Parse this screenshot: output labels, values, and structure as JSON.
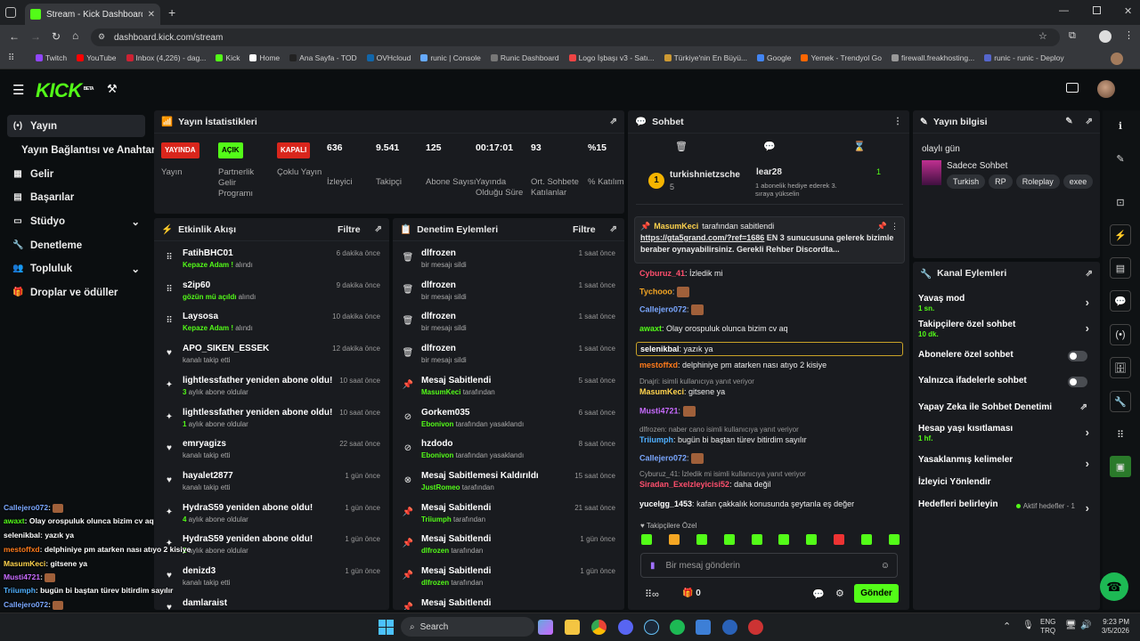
{
  "browser": {
    "tab_title": "Stream - Kick Dashboard",
    "url": "dashboard.kick.com/stream",
    "bookmarks": [
      "Twitch",
      "YouTube",
      "Inbox (4,226) - dag...",
      "Kick",
      "Home",
      "Ana Sayfa - TOD",
      "OVHcloud",
      "runic | Console",
      "Runic Dashboard",
      "Logo İşbaşı v3 - Satı...",
      "Türkiye'nin En Büyü...",
      "Google",
      "Yemek - Trendyol Go",
      "firewall.freakhosting...",
      "runic - runic - Deploy"
    ]
  },
  "kick": {
    "logo": "KICK",
    "beta": "BETA"
  },
  "sidebar": {
    "items": [
      "Yayın",
      "Yayın Bağlantısı ve Anahtarı",
      "Gelir",
      "Başarılar",
      "Stüdyo",
      "Denetleme",
      "Topluluk",
      "Droplar ve ödüller"
    ]
  },
  "stats": {
    "title": "Yayın İstatistikleri",
    "cols": [
      {
        "value": "YAYINDA",
        "label": "Yayın"
      },
      {
        "value": "AÇIK",
        "label": "Partnerlik Gelir Programı"
      },
      {
        "value": "KAPALI",
        "label": "Çoklu Yayın"
      },
      {
        "value": "636",
        "label": "İzleyici"
      },
      {
        "value": "9.541",
        "label": "Takipçi"
      },
      {
        "value": "125",
        "label": "Abone Sayısı"
      },
      {
        "value": "00:17:01",
        "label": "Yayında Olduğu Süre"
      },
      {
        "value": "93",
        "label": "Ort. Sohbete Katılanlar"
      },
      {
        "value": "%15",
        "label": "% Katılım"
      }
    ]
  },
  "activity": {
    "title": "Etkinlik Akışı",
    "filter": "Filtre",
    "items": [
      {
        "icon": "⠿",
        "title": "FatihBHC01",
        "hl": "Kepaze Adam !",
        "sub": " alındı",
        "time": "6 dakika önce"
      },
      {
        "icon": "⠿",
        "title": "s2ip60",
        "hl": "gözün mü açıldı",
        "sub": " alındı",
        "time": "9 dakika önce"
      },
      {
        "icon": "⠿",
        "title": "Laysosa",
        "hl": "Kepaze Adam !",
        "sub": " alındı",
        "time": "10 dakika önce"
      },
      {
        "icon": "♥",
        "title": "APO_SIKEN_ESSEK",
        "hl": "",
        "sub": "kanalı takip etti",
        "time": "12 dakika önce"
      },
      {
        "icon": "✦",
        "title": "lightlessfather yeniden abone oldu!",
        "hl": "3",
        "sub": " aylık abone oldular",
        "time": "10 saat önce"
      },
      {
        "icon": "✦",
        "title": "lightlessfather yeniden abone oldu!",
        "hl": "1",
        "sub": " aylık abone oldular",
        "time": "10 saat önce"
      },
      {
        "icon": "♥",
        "title": "emryagizs",
        "hl": "",
        "sub": "kanalı takip etti",
        "time": "22 saat önce"
      },
      {
        "icon": "♥",
        "title": "hayalet2877",
        "hl": "",
        "sub": "kanalı takip etti",
        "time": "1 gün önce"
      },
      {
        "icon": "✦",
        "title": "HydraS59 yeniden abone oldu!",
        "hl": "4",
        "sub": " aylık abone oldular",
        "time": "1 gün önce"
      },
      {
        "icon": "✦",
        "title": "HydraS59 yeniden abone oldu!",
        "hl": "2",
        "sub": " aylık abone oldular",
        "time": "1 gün önce"
      },
      {
        "icon": "♥",
        "title": "denizd3",
        "hl": "",
        "sub": "kanalı takip etti",
        "time": "1 gün önce"
      },
      {
        "icon": "♥",
        "title": "damlaraist",
        "hl": "",
        "sub": "",
        "time": ""
      }
    ]
  },
  "moderation": {
    "title": "Denetim Eylemleri",
    "filter": "Filtre",
    "items": [
      {
        "icon": "🗑",
        "title": "dlfrozen",
        "hl": "",
        "sub": "bir mesajı sildi",
        "time": "1 saat önce"
      },
      {
        "icon": "🗑",
        "title": "dlfrozen",
        "hl": "",
        "sub": "bir mesajı sildi",
        "time": "1 saat önce"
      },
      {
        "icon": "🗑",
        "title": "dlfrozen",
        "hl": "",
        "sub": "bir mesajı sildi",
        "time": "1 saat önce"
      },
      {
        "icon": "🗑",
        "title": "dlfrozen",
        "hl": "",
        "sub": "bir mesajı sildi",
        "time": "1 saat önce"
      },
      {
        "icon": "📌",
        "title": "Mesaj Sabitlendi",
        "hl": "MasumKeci",
        "sub": " tarafından",
        "time": "5 saat önce"
      },
      {
        "icon": "⊘",
        "title": "Gorkem035",
        "hl": "Ebonivon",
        "sub": " tarafından yasaklandı",
        "time": "6 saat önce"
      },
      {
        "icon": "⊘",
        "title": "hzdodo",
        "hl": "Ebonivon",
        "sub": " tarafından yasaklandı",
        "time": "8 saat önce"
      },
      {
        "icon": "⊗",
        "title": "Mesaj Sabitlemesi Kaldırıldı",
        "hl": "JustRomeo",
        "sub": " tarafından",
        "time": "15 saat önce"
      },
      {
        "icon": "📌",
        "title": "Mesaj Sabitlendi",
        "hl": "Triiumph",
        "sub": " tarafından",
        "time": "21 saat önce"
      },
      {
        "icon": "📌",
        "title": "Mesaj Sabitlendi",
        "hl": "dlfrozen",
        "sub": " tarafından",
        "time": "1 gün önce"
      },
      {
        "icon": "📌",
        "title": "Mesaj Sabitlendi",
        "hl": "dlfrozen",
        "sub": " tarafından",
        "time": "1 gün önce"
      },
      {
        "icon": "📌",
        "title": "Mesaj Sabitlendi",
        "hl": "",
        "sub": "",
        "time": ""
      }
    ]
  },
  "chat": {
    "title": "Sohbet",
    "leader": {
      "user1": "turkishnietzsche",
      "user1_count": "5",
      "user2": "lear28",
      "user2_count": "1",
      "user2_sub": "1 abonelik hediye ederek 3. sıraya yükselin",
      "rank": "1"
    },
    "pinned": {
      "by": "MasumKeci",
      "by_suffix": "tarafından sabitlendi",
      "link": "https://gta5grand.com/?ref=1686",
      "text": " EN 3 sunucusuna gelerek bizimle beraber oynayabilirsiniz. Gerekli Rehber Discordta..."
    },
    "messages": [
      {
        "user": "Cyburuz_41",
        "color": "#ff4f6d",
        "text": "İzledik mi",
        "reply": ""
      },
      {
        "user": "Tychooo",
        "color": "#f5a623",
        "text": "",
        "reply": ""
      },
      {
        "user": "Callejero072",
        "color": "#7aa7ff",
        "text": "",
        "reply": ""
      },
      {
        "user": "awaxt",
        "color": "#53fc18",
        "text": "Olay orospuluk olunca bizim cv aq",
        "reply": ""
      },
      {
        "user": "selenikbal",
        "color": "#ffffff",
        "text": "yazık ya",
        "reply": ""
      },
      {
        "user": "mestoffxd",
        "color": "#ff7a1a",
        "text": "delphiniye pm atarken nası atıyo 2 kisiye",
        "reply": ""
      },
      {
        "user": "MasumKeci",
        "color": "#ffd34d",
        "text": "gitsene ya",
        "reply": "Dnajri:  isimli kullanıcıya yanıt veriyor"
      },
      {
        "user": "Musti4721",
        "color": "#c86bff",
        "text": "",
        "reply": ""
      },
      {
        "user": "Triiumph",
        "color": "#4fb0ff",
        "text": "bugün bi baştan türev bitirdim sayılır",
        "reply": "dlfrozen: naber cano isimli kullanıcıya yanıt veriyor"
      },
      {
        "user": "Callejero072",
        "color": "#7aa7ff",
        "text": "",
        "reply": ""
      },
      {
        "user": "Siradan_Exelzleyicisi52",
        "color": "#ff4f6d",
        "text": "daha değil",
        "reply": "Cyburuz_41: İzledik mi  isimli kullanıcıya yanıt veriyor"
      },
      {
        "user": "yucelgg_1453",
        "color": "#ffffff",
        "text": "kafan çakkalık konusunda şeytanla eş değer",
        "reply": ""
      }
    ],
    "followers_only": "Takipçilere Özel",
    "input_placeholder": "Bir mesaj gönderin",
    "points": "0",
    "send": "Gönder"
  },
  "stream_info": {
    "title": "Yayın bilgisi",
    "stream_title": "olaylı gün",
    "category": "Sadece Sohbet",
    "tags": [
      "Turkish",
      "RP",
      "Roleplay",
      "exee"
    ]
  },
  "channel_actions": {
    "title": "Kanal Eylemleri",
    "items": [
      {
        "label": "Yavaş mod",
        "sub": "1 sn.",
        "ctl": "chev"
      },
      {
        "label": "Takipçilere özel sohbet",
        "sub": "10 dk.",
        "ctl": "chev"
      },
      {
        "label": "Abonelere özel sohbet",
        "sub": "",
        "ctl": "toggle"
      },
      {
        "label": "Yalnızca ifadelerle sohbet",
        "sub": "",
        "ctl": "toggle"
      },
      {
        "label": "Yapay Zeka ile Sohbet Denetimi",
        "sub": "",
        "ctl": "ext"
      },
      {
        "label": "Hesap yaşı kısıtlaması",
        "sub": "1 hf.",
        "ctl": "chev"
      },
      {
        "label": "Yasaklanmış kelimeler",
        "sub": "",
        "ctl": "chev"
      },
      {
        "label": "İzleyici Yönlendir",
        "sub": "",
        "ctl": ""
      },
      {
        "label": "Hedefleri belirleyin",
        "sub": "",
        "ctl": "chev"
      }
    ],
    "goal_status": "Aktif hedefler - 1"
  },
  "overlay": [
    {
      "user": "Callejero072",
      "color": "#7aa7ff",
      "text": ""
    },
    {
      "user": "awaxt",
      "color": "#53fc18",
      "text": "Olay orospuluk olunca bizim cv aq"
    },
    {
      "user": "selenikbal",
      "color": "#ffffff",
      "text": "yazık ya"
    },
    {
      "user": "mestoffxd",
      "color": "#ff7a1a",
      "text": "delphiniye pm atarken nası atıyo 2 kisiye"
    },
    {
      "user": "MasumKeci",
      "color": "#ffd34d",
      "text": "gitsene ya"
    },
    {
      "user": "Musti4721",
      "color": "#c86bff",
      "text": ""
    },
    {
      "user": "Triiumph",
      "color": "#4fb0ff",
      "text": "bugün bi baştan türev bitirdim sayılır"
    },
    {
      "user": "Callejero072",
      "color": "#7aa7ff",
      "text": ""
    },
    {
      "user": "Siradan_Exelzleyicisi52",
      "color": "#ff4f6d",
      "text": "daha değil"
    },
    {
      "user": "yucelgg_1453",
      "color": "#ffffff",
      "text": "kafan çakkalık konusunda şeytanla eş değer"
    }
  ],
  "taskbar": {
    "search": "Search",
    "lang1": "ENG",
    "lang2": "TRQ",
    "time": "9:23 PM",
    "date": "3/5/2026"
  }
}
